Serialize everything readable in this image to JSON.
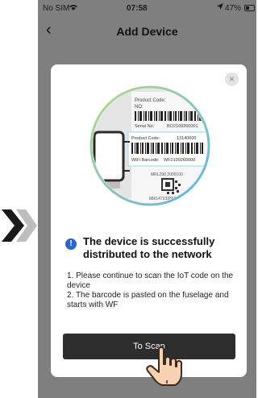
{
  "status_bar": {
    "carrier": "No SIM",
    "time": "07:58",
    "battery": "47%"
  },
  "header": {
    "title": "Add Device"
  },
  "modal": {
    "close": "×",
    "illustration": {
      "product_code_label_1": "Product Code:",
      "no_label": "NO:",
      "serial_label": "Serial No:",
      "serial_value": "BO2109260001",
      "product_code_label_2": "Product Code:",
      "product_code_value": "13140000",
      "wifi_barcode_label": "WiFi Barcode:",
      "wifi_barcode_value": "WF2109260000",
      "mrl_label": "MRL290 2000100",
      "number_label": "8861472335651"
    },
    "headline": "The device is successfully distributed to the network",
    "instructions": [
      "1. Please continue to scan the IoT code on the device",
      "2. The barcode is pasted on the fuselage and starts with WF"
    ],
    "button": "To Scan"
  },
  "colors": {
    "overlay": "#7f7f7f",
    "button": "#2d2d2d",
    "info": "#2b65c5"
  }
}
